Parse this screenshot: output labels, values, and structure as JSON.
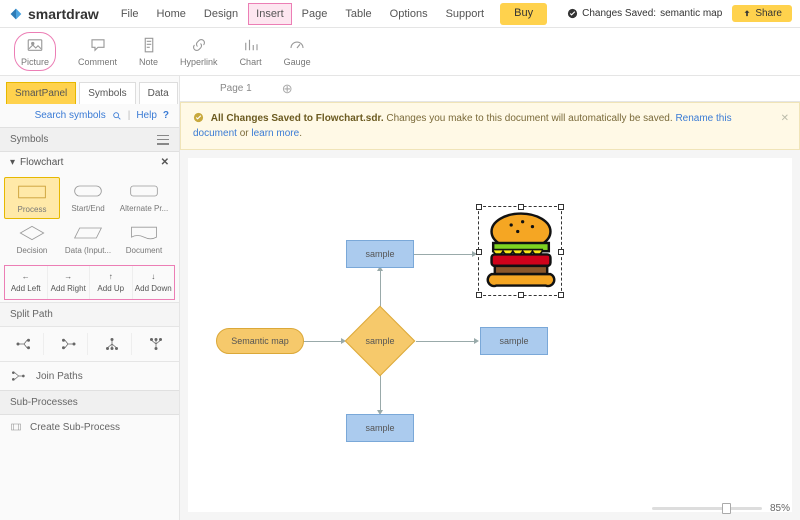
{
  "app": {
    "name": "smartdraw"
  },
  "menu": {
    "items": [
      "File",
      "Home",
      "Design",
      "Insert",
      "Page",
      "Table",
      "Options",
      "Support"
    ],
    "highlighted": "Insert",
    "buy": "Buy"
  },
  "status": {
    "saved_prefix": "Changes Saved:",
    "saved_name": "semantic map",
    "share": "Share"
  },
  "toolbar": {
    "items": [
      {
        "id": "picture",
        "label": "Picture"
      },
      {
        "id": "comment",
        "label": "Comment"
      },
      {
        "id": "note",
        "label": "Note"
      },
      {
        "id": "hyperlink",
        "label": "Hyperlink"
      },
      {
        "id": "chart",
        "label": "Chart"
      },
      {
        "id": "gauge",
        "label": "Gauge"
      }
    ],
    "highlighted": "picture"
  },
  "sidebar": {
    "tabs": [
      "SmartPanel",
      "Symbols",
      "Data"
    ],
    "active": "SmartPanel",
    "search": "Search symbols",
    "help": "Help",
    "symbols_header": "Symbols",
    "category": "Flowchart",
    "shapes": [
      {
        "id": "process",
        "label": "Process"
      },
      {
        "id": "startend",
        "label": "Start/End"
      },
      {
        "id": "altproc",
        "label": "Alternate Pr..."
      },
      {
        "id": "decision",
        "label": "Decision"
      },
      {
        "id": "datainput",
        "label": "Data (Input..."
      },
      {
        "id": "document",
        "label": "Document"
      }
    ],
    "selected_shape": "process",
    "add": {
      "left": "Add Left",
      "right": "Add Right",
      "up": "Add Up",
      "down": "Add Down"
    },
    "split_header": "Split Path",
    "join_header": "Join Paths",
    "sub_header": "Sub-Processes",
    "create_sub": "Create Sub-Process"
  },
  "pages": {
    "current": "Page 1"
  },
  "banner": {
    "bold": "All Changes Saved to Flowchart.sdr.",
    "text": " Changes you make to this document will automatically be saved. ",
    "rename": "Rename this document",
    "or": " or ",
    "learn": "learn more"
  },
  "diagram": {
    "start": "Semantic map",
    "center": "sample",
    "top": "sample",
    "right": "sample",
    "bottom": "sample"
  },
  "zoom": {
    "value": "85%",
    "position": 70
  }
}
